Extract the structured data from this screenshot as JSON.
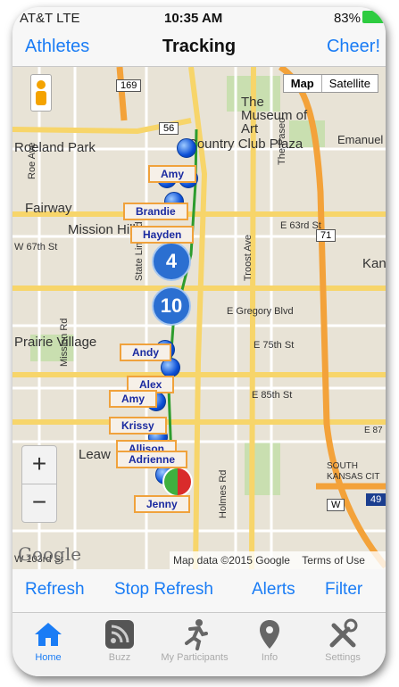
{
  "status_bar": {
    "carrier": "AT&T  LTE",
    "time": "10:35 AM",
    "battery": "83%"
  },
  "nav": {
    "left": "Athletes",
    "title": "Tracking",
    "right": "Cheer!"
  },
  "map": {
    "type_toggle": [
      "Map",
      "Satellite"
    ],
    "places": [
      "Roeland Park",
      "Fairway",
      "Mission Hills",
      "Country Club Plaza",
      "The Museum of Art",
      "Emanuel",
      "Kans",
      "Prairie Village",
      "Leaw",
      "SOUTH KANSAS CIT"
    ],
    "streets": [
      "Roe Ave",
      "Mission Rd",
      "State Line Rd",
      "Troost Ave",
      "The Paseo",
      "E 63rd St",
      "E Gregory Blvd",
      "E 75th St",
      "E 85th St",
      "E 87",
      "Holmes Rd",
      "W 67th St",
      "W 103rd St"
    ],
    "shields": [
      "169",
      "56",
      "71",
      "49",
      "W"
    ],
    "attribution": "Map data ©2015 Google",
    "terms": "Terms of Use",
    "google_logo": "Google",
    "zoom_in": "+",
    "zoom_out": "−"
  },
  "athletes": [
    "Amy",
    "Brandie",
    "Hayden",
    "Andy",
    "Alex",
    "Amy",
    "Krissy",
    "Allison",
    "Adrienne",
    "Jenny"
  ],
  "clusters": [
    "4",
    "10"
  ],
  "actions": [
    "Refresh",
    "Stop Refresh",
    "Alerts",
    "Filter"
  ],
  "tabs": [
    "Home",
    "Buzz",
    "My Participants",
    "Info",
    "Settings"
  ],
  "colors": {
    "accent": "#1a7cf5",
    "label_border": "#f0a23c",
    "marker": "#0b4fd6"
  }
}
